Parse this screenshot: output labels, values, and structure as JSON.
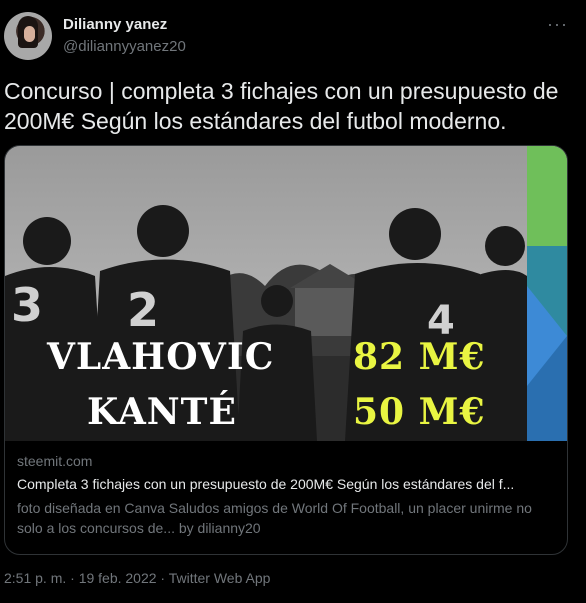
{
  "author": {
    "name": "Dilianny yanez",
    "handle": "@diliannyyanez20"
  },
  "menu": {
    "more_label": "···"
  },
  "tweet": {
    "text": "Concurso | completa 3 fichajes con un presupuesto de 200M€ Según los estándares del futbol moderno."
  },
  "card": {
    "image_overlay": {
      "player_1": "VLAHOVIC",
      "price_1": "82 M€",
      "player_2": "KANTÉ",
      "price_2": "50 M€"
    },
    "domain": "steemit.com",
    "title": "Completa 3 fichajes con un presupuesto de 200M€ Según los estándares del f...",
    "description": "foto diseñada en Canva Saludos amigos de World Of Football, un placer unirme no solo a los concursos de... by dilianny20"
  },
  "meta": {
    "timestamp": "2:51 p. m. · 19 feb. 2022 · Twitter Web App"
  },
  "colors": {
    "background": "#000000",
    "text_primary": "#e7e9ea",
    "text_secondary": "#71767b",
    "price_yellow": "#e9f542"
  }
}
